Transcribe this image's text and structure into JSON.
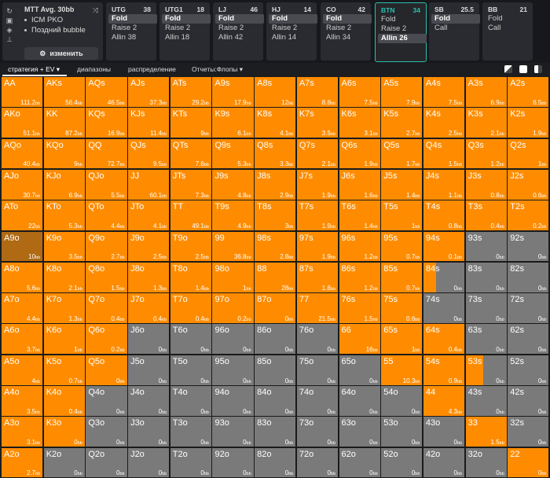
{
  "colors": {
    "raise": "#ff8c00",
    "fold": "#7a7a7a",
    "selected": "#b06a14",
    "accent": "#2bc0b0"
  },
  "game": {
    "title": "MTT  Avg. 30bb",
    "lines": [
      "ICM PKO",
      "Поздний bubble"
    ],
    "icons": [
      "refresh-icon",
      "save-icon",
      "gamepad-icon",
      "align-icon",
      "shuffle-icon"
    ],
    "edit_label": "изменить"
  },
  "positions": [
    {
      "name": "UTG",
      "stack": "38",
      "actions": [
        {
          "label": "Fold",
          "selected": true
        },
        {
          "label": "Raise 2",
          "selected": false
        },
        {
          "label": "Allin 38",
          "selected": false
        }
      ]
    },
    {
      "name": "UTG1",
      "stack": "18",
      "actions": [
        {
          "label": "Fold",
          "selected": true
        },
        {
          "label": "Raise 2",
          "selected": false
        },
        {
          "label": "Allin 18",
          "selected": false
        }
      ]
    },
    {
      "name": "LJ",
      "stack": "46",
      "actions": [
        {
          "label": "Fold",
          "selected": true
        },
        {
          "label": "Raise 2",
          "selected": false
        },
        {
          "label": "Allin 42",
          "selected": false
        }
      ]
    },
    {
      "name": "HJ",
      "stack": "14",
      "actions": [
        {
          "label": "Fold",
          "selected": true
        },
        {
          "label": "Raise 2",
          "selected": false
        },
        {
          "label": "Allin 14",
          "selected": false
        }
      ]
    },
    {
      "name": "CO",
      "stack": "42",
      "actions": [
        {
          "label": "Fold",
          "selected": true
        },
        {
          "label": "Raise 2",
          "selected": false
        },
        {
          "label": "Allin 34",
          "selected": false
        }
      ]
    },
    {
      "name": "BTN",
      "stack": "34",
      "active": true,
      "actions": [
        {
          "label": "Fold",
          "selected": false
        },
        {
          "label": "Raise 2",
          "selected": false
        },
        {
          "label": "Allin 26",
          "selected": true
        }
      ]
    },
    {
      "name": "SB",
      "stack": "25.5",
      "actions": [
        {
          "label": "Fold",
          "selected": true
        },
        {
          "label": "Call",
          "selected": false
        }
      ]
    },
    {
      "name": "BB",
      "stack": "21",
      "actions": [
        {
          "label": "Fold",
          "selected": false
        },
        {
          "label": "Call",
          "selected": false
        }
      ]
    }
  ],
  "tabs": [
    "стратегия + EV",
    "диапазоны",
    "распределение",
    "Отчеты:Флопы"
  ],
  "ev_unit": "bb",
  "grid": [
    [
      {
        "h": "AA",
        "ev": "111.2",
        "f": 1
      },
      {
        "h": "AKs",
        "ev": "56.4",
        "f": 1
      },
      {
        "h": "AQs",
        "ev": "46.5",
        "f": 1
      },
      {
        "h": "AJs",
        "ev": "37.3",
        "f": 1
      },
      {
        "h": "ATs",
        "ev": "29.2",
        "f": 1
      },
      {
        "h": "A9s",
        "ev": "17.9",
        "f": 1
      },
      {
        "h": "A8s",
        "ev": "12",
        "f": 1
      },
      {
        "h": "A7s",
        "ev": "8.8",
        "f": 1
      },
      {
        "h": "A6s",
        "ev": "7.5",
        "f": 1
      },
      {
        "h": "A5s",
        "ev": "7.9",
        "f": 1
      },
      {
        "h": "A4s",
        "ev": "7.5",
        "f": 1
      },
      {
        "h": "A3s",
        "ev": "6.9",
        "f": 1
      },
      {
        "h": "A2s",
        "ev": "6.5",
        "f": 1
      }
    ],
    [
      {
        "h": "AKo",
        "ev": "51.1",
        "f": 1
      },
      {
        "h": "KK",
        "ev": "87.2",
        "f": 1
      },
      {
        "h": "KQs",
        "ev": "16.9",
        "f": 1
      },
      {
        "h": "KJs",
        "ev": "11.4",
        "f": 1
      },
      {
        "h": "KTs",
        "ev": "9",
        "f": 1
      },
      {
        "h": "K9s",
        "ev": "6.1",
        "f": 1
      },
      {
        "h": "K8s",
        "ev": "4.1",
        "f": 1
      },
      {
        "h": "K7s",
        "ev": "3.5",
        "f": 1
      },
      {
        "h": "K6s",
        "ev": "3.1",
        "f": 1
      },
      {
        "h": "K5s",
        "ev": "2.7",
        "f": 1
      },
      {
        "h": "K4s",
        "ev": "2.5",
        "f": 1
      },
      {
        "h": "K3s",
        "ev": "2.1",
        "f": 1
      },
      {
        "h": "K2s",
        "ev": "1.9",
        "f": 1
      }
    ],
    [
      {
        "h": "AQo",
        "ev": "40.4",
        "f": 1
      },
      {
        "h": "KQo",
        "ev": "9",
        "f": 1
      },
      {
        "h": "QQ",
        "ev": "72.7",
        "f": 1
      },
      {
        "h": "QJs",
        "ev": "9.5",
        "f": 1
      },
      {
        "h": "QTs",
        "ev": "7.6",
        "f": 1
      },
      {
        "h": "Q9s",
        "ev": "5.3",
        "f": 1
      },
      {
        "h": "Q8s",
        "ev": "3.3",
        "f": 1
      },
      {
        "h": "Q7s",
        "ev": "2.1",
        "f": 1
      },
      {
        "h": "Q6s",
        "ev": "1.9",
        "f": 1
      },
      {
        "h": "Q5s",
        "ev": "1.7",
        "f": 1
      },
      {
        "h": "Q4s",
        "ev": "1.5",
        "f": 1
      },
      {
        "h": "Q3s",
        "ev": "1.2",
        "f": 1
      },
      {
        "h": "Q2s",
        "ev": "1",
        "f": 1
      }
    ],
    [
      {
        "h": "AJo",
        "ev": "30.7",
        "f": 1
      },
      {
        "h": "KJo",
        "ev": "6.9",
        "f": 1
      },
      {
        "h": "QJo",
        "ev": "5.5",
        "f": 1
      },
      {
        "h": "JJ",
        "ev": "60.1",
        "f": 1
      },
      {
        "h": "JTs",
        "ev": "7.3",
        "f": 1
      },
      {
        "h": "J9s",
        "ev": "4.8",
        "f": 1
      },
      {
        "h": "J8s",
        "ev": "2.9",
        "f": 1
      },
      {
        "h": "J7s",
        "ev": "1.9",
        "f": 1
      },
      {
        "h": "J6s",
        "ev": "1.6",
        "f": 1
      },
      {
        "h": "J5s",
        "ev": "1.4",
        "f": 1
      },
      {
        "h": "J4s",
        "ev": "1.1",
        "f": 1
      },
      {
        "h": "J3s",
        "ev": "0.8",
        "f": 1
      },
      {
        "h": "J2s",
        "ev": "0.6",
        "f": 1
      }
    ],
    [
      {
        "h": "ATo",
        "ev": "22",
        "f": 1
      },
      {
        "h": "KTo",
        "ev": "5.3",
        "f": 1
      },
      {
        "h": "QTo",
        "ev": "4.4",
        "f": 1
      },
      {
        "h": "JTo",
        "ev": "4.1",
        "f": 1
      },
      {
        "h": "TT",
        "ev": "49.1",
        "f": 1
      },
      {
        "h": "T9s",
        "ev": "4.9",
        "f": 1
      },
      {
        "h": "T8s",
        "ev": "3",
        "f": 1
      },
      {
        "h": "T7s",
        "ev": "1.9",
        "f": 1
      },
      {
        "h": "T6s",
        "ev": "1.4",
        "f": 1
      },
      {
        "h": "T5s",
        "ev": "1",
        "f": 1
      },
      {
        "h": "T4s",
        "ev": "0.8",
        "f": 1
      },
      {
        "h": "T3s",
        "ev": "0.4",
        "f": 1
      },
      {
        "h": "T2s",
        "ev": "0.2",
        "f": 1
      }
    ],
    [
      {
        "h": "A9o",
        "ev": "10",
        "f": 1,
        "sel": true
      },
      {
        "h": "K9o",
        "ev": "3.5",
        "f": 1
      },
      {
        "h": "Q9o",
        "ev": "2.7",
        "f": 1
      },
      {
        "h": "J9o",
        "ev": "2.5",
        "f": 1
      },
      {
        "h": "T9o",
        "ev": "2.5",
        "f": 1
      },
      {
        "h": "99",
        "ev": "36.8",
        "f": 1
      },
      {
        "h": "98s",
        "ev": "2.8",
        "f": 1
      },
      {
        "h": "97s",
        "ev": "1.9",
        "f": 1
      },
      {
        "h": "96s",
        "ev": "1.2",
        "f": 1
      },
      {
        "h": "95s",
        "ev": "0.7",
        "f": 1
      },
      {
        "h": "94s",
        "ev": "0.1",
        "f": 1
      },
      {
        "h": "93s",
        "ev": "0",
        "f": 0
      },
      {
        "h": "92s",
        "ev": "0",
        "f": 0
      }
    ],
    [
      {
        "h": "A8o",
        "ev": "5.6",
        "f": 1
      },
      {
        "h": "K8o",
        "ev": "2.1",
        "f": 1
      },
      {
        "h": "Q8o",
        "ev": "1.5",
        "f": 1
      },
      {
        "h": "J8o",
        "ev": "1.3",
        "f": 1
      },
      {
        "h": "T8o",
        "ev": "1.4",
        "f": 1
      },
      {
        "h": "98o",
        "ev": "1",
        "f": 1
      },
      {
        "h": "88",
        "ev": "28",
        "f": 1
      },
      {
        "h": "87s",
        "ev": "1.8",
        "f": 1
      },
      {
        "h": "86s",
        "ev": "1.2",
        "f": 1
      },
      {
        "h": "85s",
        "ev": "0.7",
        "f": 1
      },
      {
        "h": "84s",
        "ev": "0",
        "f": 0.3
      },
      {
        "h": "83s",
        "ev": "0",
        "f": 0
      },
      {
        "h": "82s",
        "ev": "0",
        "f": 0
      }
    ],
    [
      {
        "h": "A7o",
        "ev": "4.4",
        "f": 1
      },
      {
        "h": "K7o",
        "ev": "1.3",
        "f": 1
      },
      {
        "h": "Q7o",
        "ev": "0.4",
        "f": 1
      },
      {
        "h": "J7o",
        "ev": "0.4",
        "f": 1
      },
      {
        "h": "T7o",
        "ev": "0.4",
        "f": 1
      },
      {
        "h": "97o",
        "ev": "0.2",
        "f": 1
      },
      {
        "h": "87o",
        "ev": "0",
        "f": 1
      },
      {
        "h": "77",
        "ev": "21.5",
        "f": 1
      },
      {
        "h": "76s",
        "ev": "1.5",
        "f": 1
      },
      {
        "h": "75s",
        "ev": "0.6",
        "f": 1
      },
      {
        "h": "74s",
        "ev": "0",
        "f": 0
      },
      {
        "h": "73s",
        "ev": "0",
        "f": 0
      },
      {
        "h": "72s",
        "ev": "0",
        "f": 0
      }
    ],
    [
      {
        "h": "A6o",
        "ev": "3.7",
        "f": 1
      },
      {
        "h": "K6o",
        "ev": "1",
        "f": 1
      },
      {
        "h": "Q6o",
        "ev": "0.2",
        "f": 1
      },
      {
        "h": "J6o",
        "ev": "0",
        "f": 0
      },
      {
        "h": "T6o",
        "ev": "0",
        "f": 0
      },
      {
        "h": "96o",
        "ev": "0",
        "f": 0
      },
      {
        "h": "86o",
        "ev": "0",
        "f": 0
      },
      {
        "h": "76o",
        "ev": "0",
        "f": 0
      },
      {
        "h": "66",
        "ev": "16",
        "f": 1
      },
      {
        "h": "65s",
        "ev": "1",
        "f": 1
      },
      {
        "h": "64s",
        "ev": "0.4",
        "f": 1
      },
      {
        "h": "63s",
        "ev": "0",
        "f": 0
      },
      {
        "h": "62s",
        "ev": "0",
        "f": 0
      }
    ],
    [
      {
        "h": "A5o",
        "ev": "4",
        "f": 1
      },
      {
        "h": "K5o",
        "ev": "0.7",
        "f": 1
      },
      {
        "h": "Q5o",
        "ev": "0",
        "f": 1
      },
      {
        "h": "J5o",
        "ev": "0",
        "f": 0
      },
      {
        "h": "T5o",
        "ev": "0",
        "f": 0
      },
      {
        "h": "95o",
        "ev": "0",
        "f": 0
      },
      {
        "h": "85o",
        "ev": "0",
        "f": 0
      },
      {
        "h": "75o",
        "ev": "0",
        "f": 0
      },
      {
        "h": "65o",
        "ev": "0",
        "f": 0
      },
      {
        "h": "55",
        "ev": "10.3",
        "f": 1
      },
      {
        "h": "54s",
        "ev": "0.9",
        "f": 1
      },
      {
        "h": "53s",
        "ev": "0",
        "f": 0.42
      },
      {
        "h": "52s",
        "ev": "0",
        "f": 0
      }
    ],
    [
      {
        "h": "A4o",
        "ev": "3.5",
        "f": 1
      },
      {
        "h": "K4o",
        "ev": "0.4",
        "f": 1
      },
      {
        "h": "Q4o",
        "ev": "0",
        "f": 0
      },
      {
        "h": "J4o",
        "ev": "0",
        "f": 0
      },
      {
        "h": "T4o",
        "ev": "0",
        "f": 0
      },
      {
        "h": "94o",
        "ev": "0",
        "f": 0
      },
      {
        "h": "84o",
        "ev": "0",
        "f": 0
      },
      {
        "h": "74o",
        "ev": "0",
        "f": 0
      },
      {
        "h": "64o",
        "ev": "0",
        "f": 0
      },
      {
        "h": "54o",
        "ev": "0",
        "f": 0
      },
      {
        "h": "44",
        "ev": "4.3",
        "f": 1
      },
      {
        "h": "43s",
        "ev": "0",
        "f": 0
      },
      {
        "h": "42s",
        "ev": "0",
        "f": 0
      }
    ],
    [
      {
        "h": "A3o",
        "ev": "3.1",
        "f": 1
      },
      {
        "h": "K3o",
        "ev": "0",
        "f": 1
      },
      {
        "h": "Q3o",
        "ev": "0",
        "f": 0
      },
      {
        "h": "J3o",
        "ev": "0",
        "f": 0
      },
      {
        "h": "T3o",
        "ev": "0",
        "f": 0
      },
      {
        "h": "93o",
        "ev": "0",
        "f": 0
      },
      {
        "h": "83o",
        "ev": "0",
        "f": 0
      },
      {
        "h": "73o",
        "ev": "0",
        "f": 0
      },
      {
        "h": "63o",
        "ev": "0",
        "f": 0
      },
      {
        "h": "53o",
        "ev": "0",
        "f": 0
      },
      {
        "h": "43o",
        "ev": "0",
        "f": 0
      },
      {
        "h": "33",
        "ev": "1.5",
        "f": 1
      },
      {
        "h": "32s",
        "ev": "0",
        "f": 0
      }
    ],
    [
      {
        "h": "A2o",
        "ev": "2.7",
        "f": 1
      },
      {
        "h": "K2o",
        "ev": "0",
        "f": 0
      },
      {
        "h": "Q2o",
        "ev": "0",
        "f": 0
      },
      {
        "h": "J2o",
        "ev": "0",
        "f": 0
      },
      {
        "h": "T2o",
        "ev": "0",
        "f": 0
      },
      {
        "h": "92o",
        "ev": "0",
        "f": 0
      },
      {
        "h": "82o",
        "ev": "0",
        "f": 0
      },
      {
        "h": "72o",
        "ev": "0",
        "f": 0
      },
      {
        "h": "62o",
        "ev": "0",
        "f": 0
      },
      {
        "h": "52o",
        "ev": "0",
        "f": 0
      },
      {
        "h": "42o",
        "ev": "0",
        "f": 0
      },
      {
        "h": "32o",
        "ev": "0",
        "f": 0
      },
      {
        "h": "22",
        "ev": "0",
        "f": 1
      }
    ]
  ]
}
